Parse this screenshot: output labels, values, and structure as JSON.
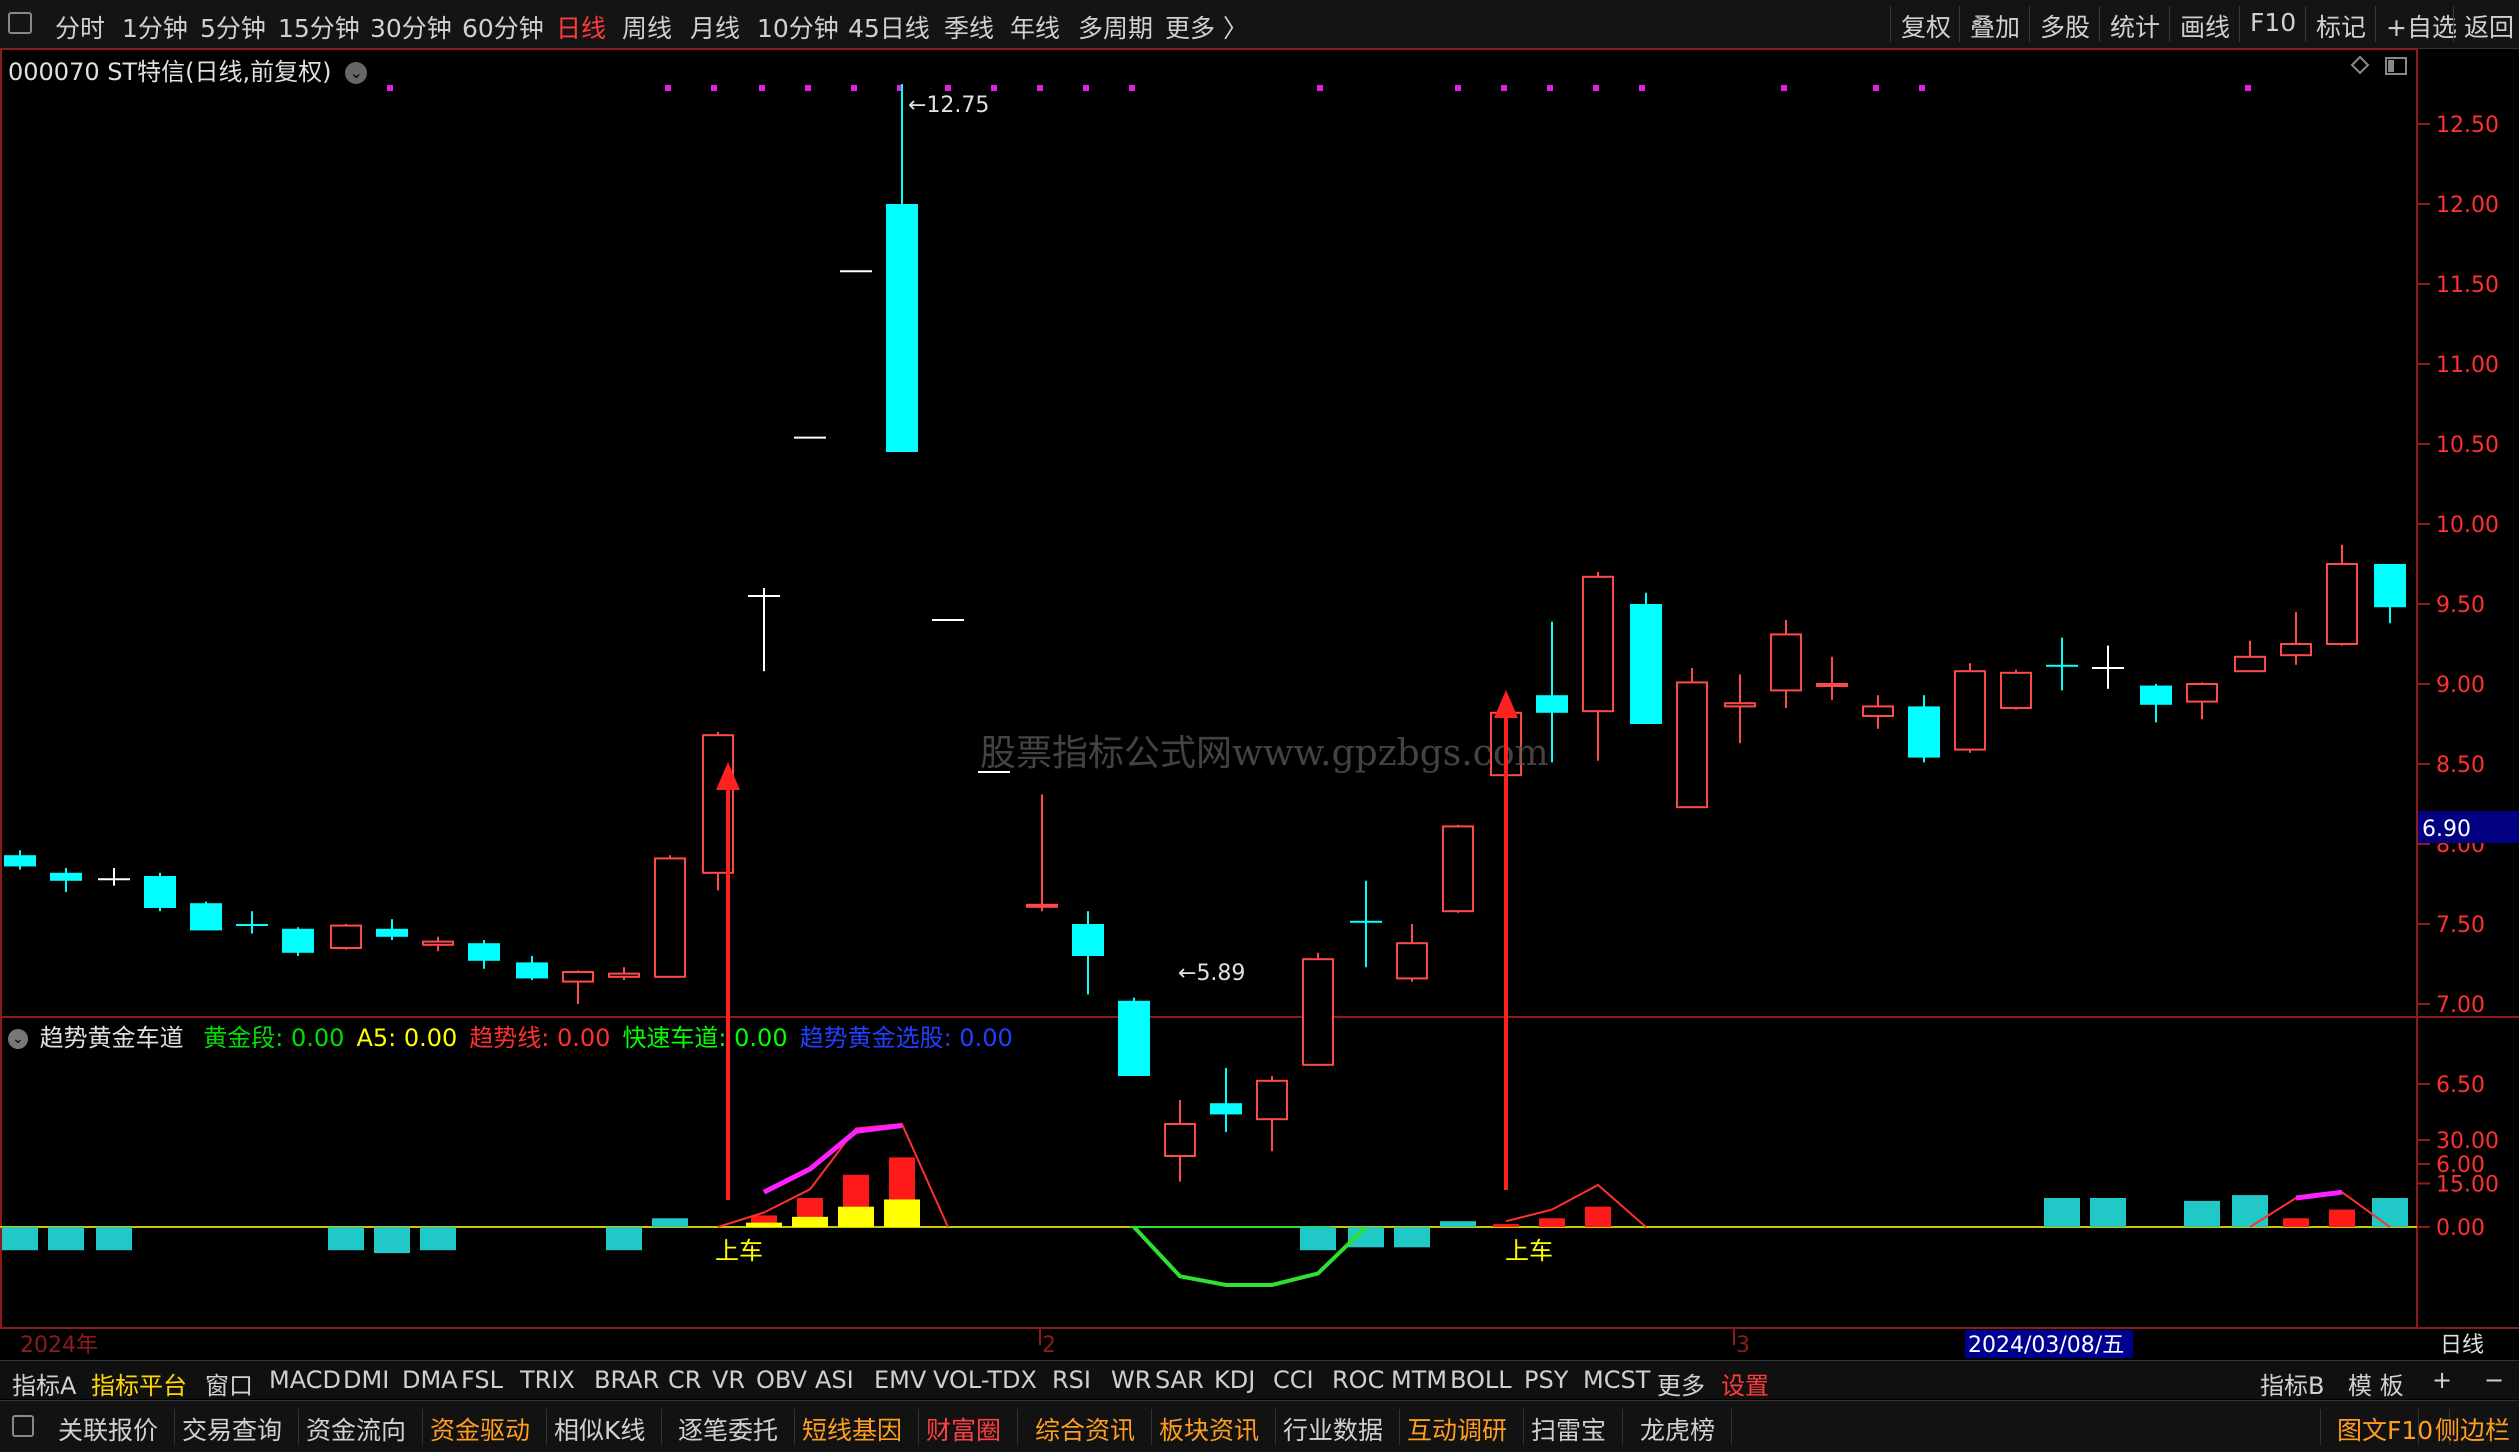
{
  "toolbar": {
    "periods": [
      "分时",
      "1分钟",
      "5分钟",
      "15分钟",
      "30分钟",
      "60分钟",
      "日线",
      "周线",
      "月线",
      "10分钟",
      "45日线",
      "季线",
      "年线",
      "多周期",
      "更多 〉"
    ],
    "active_period": "日线",
    "tools": [
      "复权",
      "叠加",
      "多股",
      "统计",
      "画线",
      "F10",
      "标记",
      "+自选",
      "返回"
    ]
  },
  "stock": {
    "title": "000070 ST特信(日线,前复权)",
    "high_label": "12.75",
    "low_label": "5.89",
    "current_price": "6.90",
    "watermark": "股票指标公式网www.gpzbgs.com"
  },
  "price_axis": [
    "12.50",
    "12.00",
    "11.50",
    "11.00",
    "10.50",
    "10.00",
    "9.50",
    "9.00",
    "8.50",
    "8.00",
    "7.50",
    "7.00",
    "6.50",
    "6.00"
  ],
  "indicator": {
    "name": "趋势黄金车道",
    "items": [
      {
        "label": "黄金段: 0.00",
        "color": "#00e000"
      },
      {
        "label": "A5: 0.00",
        "color": "#ffff00"
      },
      {
        "label": "趋势线: 0.00",
        "color": "#ff3030"
      },
      {
        "label": "快速车道: 0.00",
        "color": "#00ff00"
      },
      {
        "label": "趋势黄金选股: 0.00",
        "color": "#2040ff"
      }
    ],
    "axis": [
      "30.00",
      "15.00",
      "0.00"
    ],
    "signal_label": "上车"
  },
  "time_axis": {
    "year": "2024年",
    "m2": "2",
    "m3": "3",
    "cursor_date": "2024/03/08/五",
    "period": "日线"
  },
  "indicator_tabs": [
    "指标A",
    "指标平台",
    "窗口",
    "MACD",
    "DMI",
    "DMA",
    "FSL",
    "TRIX",
    "BRAR",
    "CR",
    "VR",
    "OBV",
    "ASI",
    "EMV",
    "VOL-TDX",
    "RSI",
    "WR",
    "SAR",
    "KDJ",
    "CCI",
    "ROC",
    "MTM",
    "BOLL",
    "PSY",
    "MCST",
    "更多",
    "设置"
  ],
  "indicator_tabs_right": [
    "指标B",
    "模 板",
    "+",
    "−"
  ],
  "bottom_buttons": [
    "关联报价",
    "交易查询",
    "资金流向",
    "资金驱动",
    "相似K线",
    "逐笔委托",
    "短线基因",
    "财富圈",
    "综合资讯",
    "板块资讯",
    "行业数据",
    "互动调研",
    "扫雷宝",
    "龙虎榜"
  ],
  "bottom_right": [
    "图文F10",
    "侧边栏"
  ]
}
